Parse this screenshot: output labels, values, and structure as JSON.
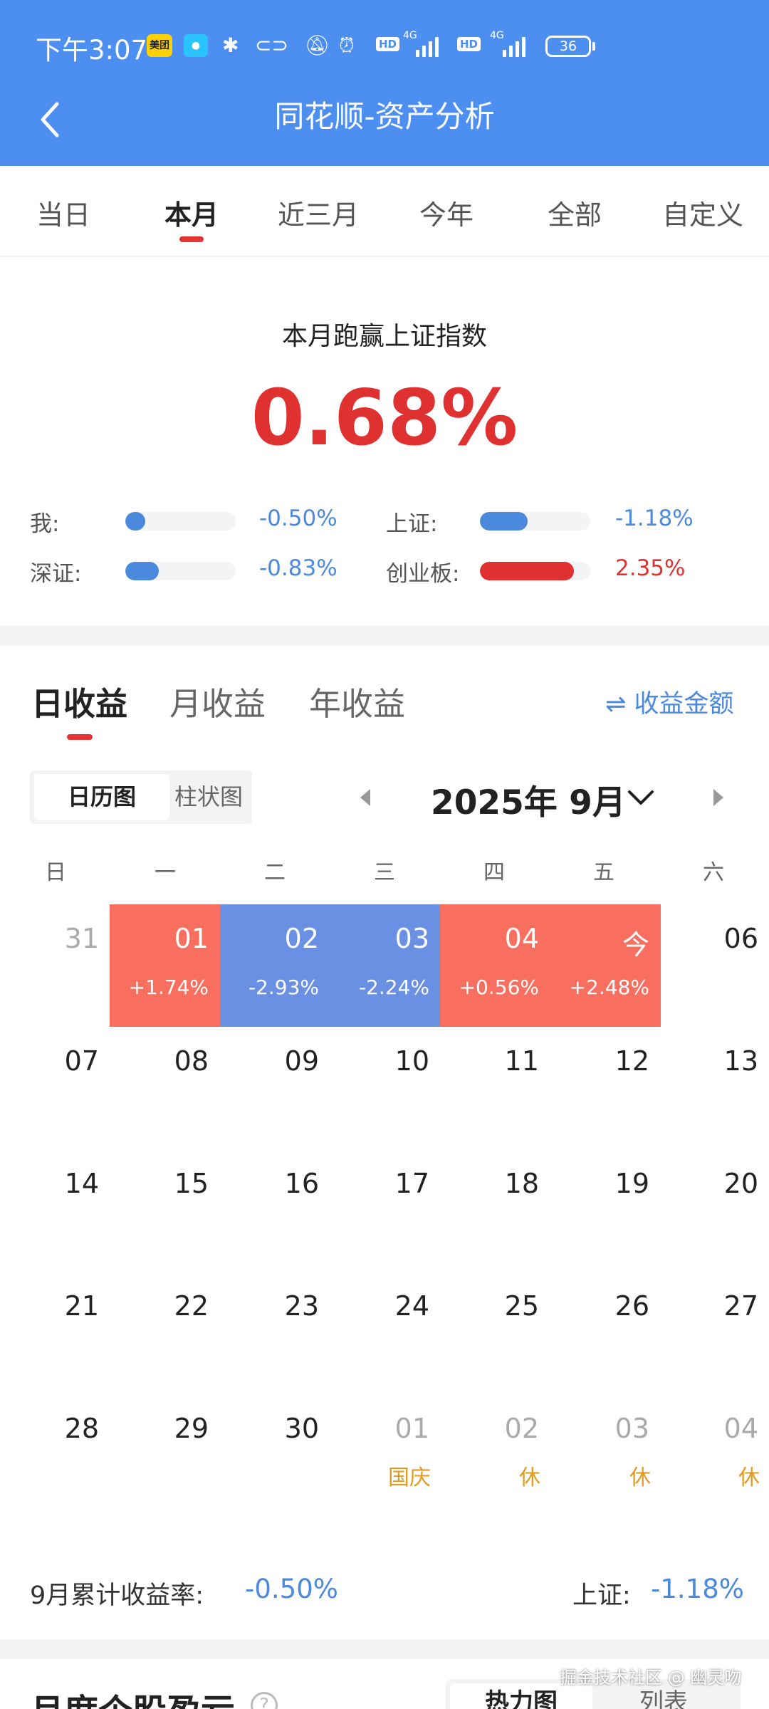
{
  "status_bar": {
    "time": "下午3:07",
    "meituan_badge": "美团",
    "net_label_1": "4G",
    "net_label_2": "4G",
    "hd_label": "HD",
    "battery": "36"
  },
  "header": {
    "title": "同花顺-资产分析"
  },
  "tabs": [
    "当日",
    "本月",
    "近三月",
    "今年",
    "全部",
    "自定义"
  ],
  "active_tab": "本月",
  "summary": {
    "label": "本月跑赢上证指数",
    "value": "0.68%",
    "comparisons": [
      {
        "label": "我:",
        "value": "-0.50%",
        "color": "#4a89dc",
        "fill": 0.18
      },
      {
        "label": "上证:",
        "value": "-1.18%",
        "color": "#4a89dc",
        "fill": 0.43
      },
      {
        "label": "深证:",
        "value": "-0.83%",
        "color": "#4a89dc",
        "fill": 0.3
      },
      {
        "label": "创业板:",
        "value": "2.35%",
        "color": "#e03131",
        "fill": 0.85
      }
    ]
  },
  "returns": {
    "tabs": [
      "日收益",
      "月收益",
      "年收益"
    ],
    "active": "日收益",
    "amount_toggle": "⇌ 收益金额",
    "view_calendar": "日历图",
    "view_bar": "柱状图",
    "month_label": "2025年 9月"
  },
  "calendar": {
    "weekdays": [
      "日",
      "一",
      "二",
      "三",
      "四",
      "五",
      "六"
    ],
    "weeks": [
      [
        {
          "day": "31",
          "muted": true
        },
        {
          "day": "01",
          "pct": "+1.74%",
          "trend": "up"
        },
        {
          "day": "02",
          "pct": "-2.93%",
          "trend": "down"
        },
        {
          "day": "03",
          "pct": "-2.24%",
          "trend": "down"
        },
        {
          "day": "04",
          "pct": "+0.56%",
          "trend": "up"
        },
        {
          "day": "今",
          "pct": "+2.48%",
          "trend": "up"
        },
        {
          "day": "06"
        }
      ],
      [
        {
          "day": "07"
        },
        {
          "day": "08"
        },
        {
          "day": "09"
        },
        {
          "day": "10"
        },
        {
          "day": "11"
        },
        {
          "day": "12"
        },
        {
          "day": "13"
        }
      ],
      [
        {
          "day": "14"
        },
        {
          "day": "15"
        },
        {
          "day": "16"
        },
        {
          "day": "17"
        },
        {
          "day": "18"
        },
        {
          "day": "19"
        },
        {
          "day": "20"
        }
      ],
      [
        {
          "day": "21"
        },
        {
          "day": "22"
        },
        {
          "day": "23"
        },
        {
          "day": "24"
        },
        {
          "day": "25"
        },
        {
          "day": "26"
        },
        {
          "day": "27"
        }
      ],
      [
        {
          "day": "28"
        },
        {
          "day": "29"
        },
        {
          "day": "30"
        },
        {
          "day": "01",
          "muted": true,
          "holiday": "国庆"
        },
        {
          "day": "02",
          "muted": true,
          "holiday": "休"
        },
        {
          "day": "03",
          "muted": true,
          "holiday": "休"
        },
        {
          "day": "04",
          "muted": true,
          "holiday": "休"
        }
      ]
    ]
  },
  "footer_summary": {
    "month_return_label": "9月累计收益率:",
    "month_return_value": "-0.50%",
    "sh_label": "上证:",
    "sh_value": "-1.18%"
  },
  "bottom": {
    "title": "月度个股盈亏",
    "help": "?",
    "view_heatmap": "热力图",
    "view_list": "列表",
    "watermark": "掘金技术社区 @ 幽灵吻"
  }
}
